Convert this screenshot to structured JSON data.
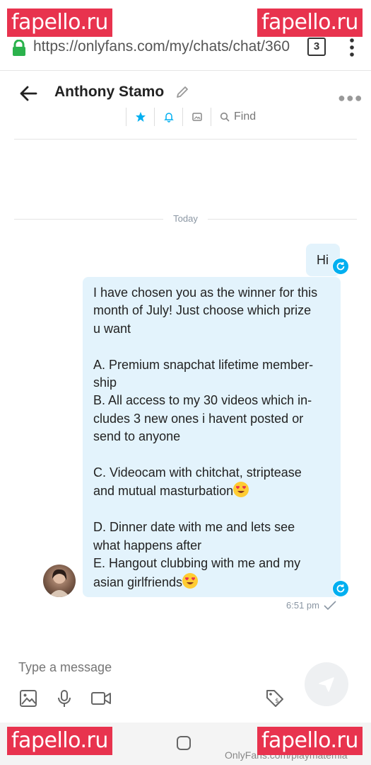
{
  "watermarks": {
    "text": "fapello.ru"
  },
  "browser": {
    "url": "https://onlyfans.com/my/chats/chat/360",
    "tab_count": "3"
  },
  "chat": {
    "contact_name": "Anthony Stamo",
    "find_label": "Find",
    "date_divider": "Today",
    "messages": [
      {
        "text": "Hi"
      },
      {
        "lines": [
          "I have chosen you as the winner for this",
          "month of July! Just choose which prize",
          "u want",
          "",
          "A. Premium snapchat lifetime member-",
          "ship",
          "B. All access to my 30 videos which in-",
          "cludes 3 new ones i havent posted or",
          "send to anyone",
          "",
          "C. Videocam with chitchat, striptease",
          "and mutual masturbation",
          "",
          "D. Dinner date with me and lets see",
          "what happens after",
          "E. Hangout clubbing with me and my",
          "asian girlfriends"
        ]
      }
    ],
    "message_time": "6:51 pm"
  },
  "composer": {
    "placeholder": "Type a message"
  },
  "footer": {
    "credit": "OnlyFans.com/playmatemia"
  },
  "colors": {
    "accent": "#00aff0",
    "bubble": "#e3f3fc",
    "watermark": "#e8334e",
    "lock": "#2bb24c"
  }
}
